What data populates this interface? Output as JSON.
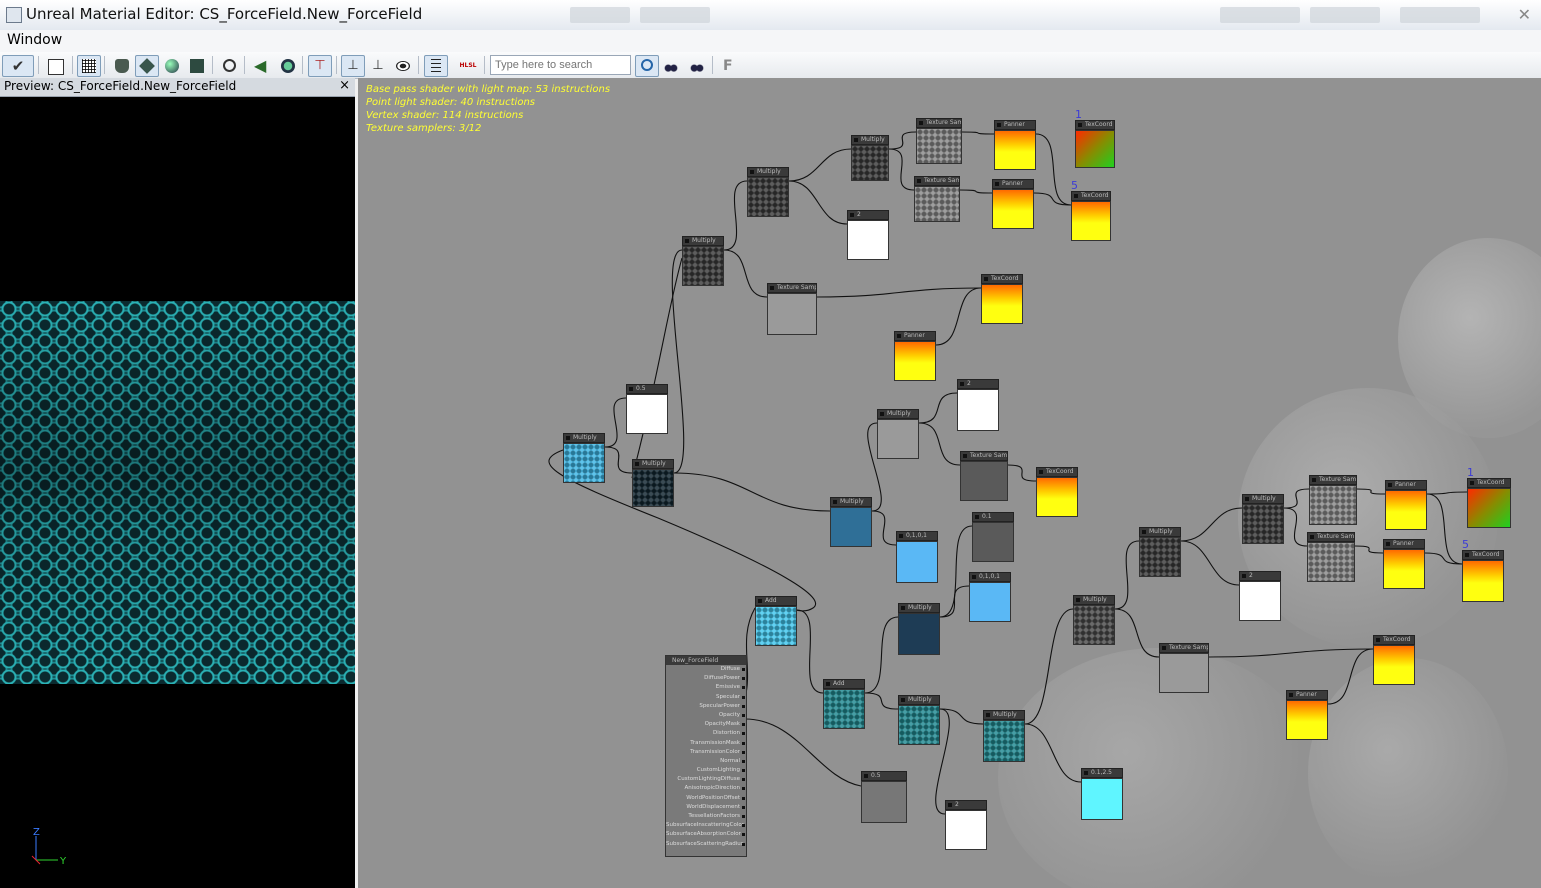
{
  "window": {
    "title": "Unreal Material Editor: CS_ForceField.New_ForceField"
  },
  "menu": {
    "window_label": "Window"
  },
  "toolbar": {
    "search_placeholder": "Type here to search",
    "hlsl_label": "HLSL",
    "f_label": "F"
  },
  "preview": {
    "title": "Preview: CS_ForceField.New_ForceField",
    "close_label": "×",
    "axis_z": "Z",
    "axis_y": "Y"
  },
  "stats": {
    "line1": "Base pass shader with light map: 53 instructions",
    "line2": "Point light shader: 40 instructions",
    "line3": "Vertex shader: 114 instructions",
    "line4": "Texture samplers: 3/12"
  },
  "nodes": [
    {
      "id": "n1",
      "title": "Multiply",
      "fill": "#3a3a3a",
      "pattern": true
    },
    {
      "id": "n2",
      "title": "Texture Sample",
      "fill": "#8a8a8a",
      "pattern": true
    },
    {
      "id": "n3",
      "title": "Panner",
      "fill": "yellow"
    },
    {
      "id": "n4",
      "title": "TexCoord",
      "fill": "greenred",
      "label": "1"
    },
    {
      "id": "n5",
      "title": "Multiply",
      "fill": "#3a3a3a",
      "pattern": true
    },
    {
      "id": "n6",
      "title": "Texture Sample",
      "fill": "#8a8a8a",
      "pattern": true
    },
    {
      "id": "n7",
      "title": "Panner",
      "fill": "yellow"
    },
    {
      "id": "n8",
      "title": "TexCoord",
      "fill": "yellow",
      "label": "5"
    },
    {
      "id": "n9",
      "title": "2",
      "fill": "#ffffff"
    },
    {
      "id": "n10",
      "title": "Multiply",
      "fill": "#3a3a3a",
      "pattern": true
    },
    {
      "id": "n11",
      "title": "Texture Sample",
      "fill": "#9a9a9a"
    },
    {
      "id": "n12",
      "title": "TexCoord",
      "fill": "yellow"
    },
    {
      "id": "n13",
      "title": "Panner",
      "fill": "yellow"
    },
    {
      "id": "n14",
      "title": "0.5",
      "fill": "#ffffff"
    },
    {
      "id": "n15",
      "title": "Multiply",
      "fill": "#3cb8e8",
      "pattern": true
    },
    {
      "id": "n16",
      "title": "Multiply",
      "fill": "#102530",
      "pattern": true
    },
    {
      "id": "n17",
      "title": "Multiply",
      "fill": "#9a9a9a"
    },
    {
      "id": "n18",
      "title": "2",
      "fill": "#ffffff"
    },
    {
      "id": "n19",
      "title": "Texture Sample",
      "fill": "#5a5a5a"
    },
    {
      "id": "n20",
      "title": "TexCoord",
      "fill": "yellow"
    },
    {
      "id": "n21",
      "title": "Multiply",
      "fill": "#2f6f97"
    },
    {
      "id": "n22",
      "title": "0,1,0,1",
      "fill": "#5ab8f5"
    },
    {
      "id": "n23",
      "title": "0.1",
      "fill": "#5a5a5a"
    },
    {
      "id": "n24",
      "title": "0,1,0,1",
      "fill": "#5ab8f5"
    },
    {
      "id": "n25",
      "title": "Add",
      "fill": "#40c8f0",
      "pattern": true
    },
    {
      "id": "n26",
      "title": "Multiply",
      "fill": "#1e3c55"
    },
    {
      "id": "n27",
      "title": "Add",
      "fill": "#1e8a92",
      "pattern": true
    },
    {
      "id": "n28",
      "title": "Multiply",
      "fill": "#1e8a92",
      "pattern": true
    },
    {
      "id": "n29",
      "title": "Multiply",
      "fill": "#1e8a92",
      "pattern": true
    },
    {
      "id": "n30",
      "title": "0.5",
      "fill": "#777777"
    },
    {
      "id": "n31",
      "title": "2",
      "fill": "#ffffff"
    },
    {
      "id": "n32",
      "title": "0.1,2.5",
      "fill": "#5ff5ff"
    },
    {
      "id": "n33",
      "title": "Multiply",
      "fill": "#3a3a3a",
      "pattern": true
    },
    {
      "id": "n34",
      "title": "Multiply",
      "fill": "#4a4a4a",
      "pattern": true
    },
    {
      "id": "n35",
      "title": "Multiply",
      "fill": "#3a3a3a",
      "pattern": true
    },
    {
      "id": "n36",
      "title": "Texture Sample",
      "fill": "#8a8a8a",
      "pattern": true
    },
    {
      "id": "n37",
      "title": "Texture Sample",
      "fill": "#8a8a8a",
      "pattern": true
    },
    {
      "id": "n38",
      "title": "Panner",
      "fill": "yellow"
    },
    {
      "id": "n39",
      "title": "Panner",
      "fill": "yellow"
    },
    {
      "id": "n40",
      "title": "TexCoord",
      "fill": "greenred",
      "label": "1"
    },
    {
      "id": "n41",
      "title": "TexCoord",
      "fill": "yellow",
      "label": "5"
    },
    {
      "id": "n42",
      "title": "2",
      "fill": "#ffffff"
    },
    {
      "id": "n43",
      "title": "Texture Sample",
      "fill": "#9a9a9a"
    },
    {
      "id": "n44",
      "title": "TexCoord",
      "fill": "yellow"
    },
    {
      "id": "n45",
      "title": "Panner",
      "fill": "yellow"
    }
  ],
  "material_node": {
    "title": "New_ForceField",
    "pins": [
      "Diffuse",
      "DiffusePower",
      "Emissive",
      "Specular",
      "SpecularPower",
      "Opacity",
      "OpacityMask",
      "Distortion",
      "TransmissionMask",
      "TransmissionColor",
      "Normal",
      "CustomLighting",
      "CustomLightingDiffuse",
      "AnisotropicDirection",
      "WorldPositionOffset",
      "WorldDisplacement",
      "TessellationFactors",
      "SubsurfaceInscatteringColor",
      "SubsurfaceAbsorptionColor",
      "SubsurfaceScatteringRadius"
    ]
  }
}
